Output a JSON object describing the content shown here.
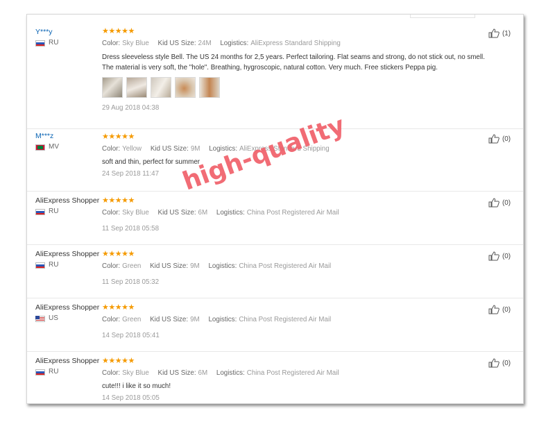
{
  "watermark": "high-quality",
  "labels": {
    "color": "Color:",
    "size": "Kid US Size:",
    "logistics": "Logistics:"
  },
  "stars": "★★★★★",
  "reviews": [
    {
      "user": "Y***y",
      "country": "RU",
      "flag": "ru",
      "color": "Sky Blue",
      "size": "24M",
      "logistics": "AliExpress Standard Shipping",
      "text": "Dress sleeveless style Bell. The US 24 months for 2,5 years. Perfect tailoring. Flat seams and strong, do not stick out, no smell. The material is very soft, the \"hole\". Breathing, hygroscopic, natural cotton. Very much. Free stickers Peppa pig.",
      "date": "29 Aug 2018 04:38",
      "helpful": "(1)"
    },
    {
      "user": "M***z",
      "country": "MV",
      "flag": "mv",
      "color": "Yellow",
      "size": "9M",
      "logistics": "AliExpress Standard Shipping",
      "text": "soft and thin, perfect for summer",
      "date": "24 Sep 2018 11:47",
      "helpful": "(0)"
    },
    {
      "user": "AliExpress Shopper",
      "country": "RU",
      "flag": "ru",
      "color": "Sky Blue",
      "size": "6M",
      "logistics": "China Post Registered Air Mail",
      "text": "",
      "date": "11 Sep 2018 05:58",
      "helpful": "(0)"
    },
    {
      "user": "AliExpress Shopper",
      "country": "RU",
      "flag": "ru",
      "color": "Green",
      "size": "9M",
      "logistics": "China Post Registered Air Mail",
      "text": "",
      "date": "11 Sep 2018 05:32",
      "helpful": "(0)"
    },
    {
      "user": "AliExpress Shopper",
      "country": "US",
      "flag": "us",
      "color": "Green",
      "size": "9M",
      "logistics": "China Post Registered Air Mail",
      "text": "",
      "date": "14 Sep 2018 05:41",
      "helpful": "(0)"
    },
    {
      "user": "AliExpress Shopper",
      "country": "RU",
      "flag": "ru",
      "color": "Sky Blue",
      "size": "6M",
      "logistics": "China Post Registered Air Mail",
      "text": "cute!!! i like it so much!",
      "date": "14 Sep 2018 05:05",
      "helpful": "(0)"
    }
  ],
  "icons": {
    "helpful": "thumbs-up-icon",
    "rating": "star-icon"
  },
  "colors": {
    "username": "#0a64b4",
    "stars": "#f59a00",
    "watermark": "#f0606a"
  }
}
